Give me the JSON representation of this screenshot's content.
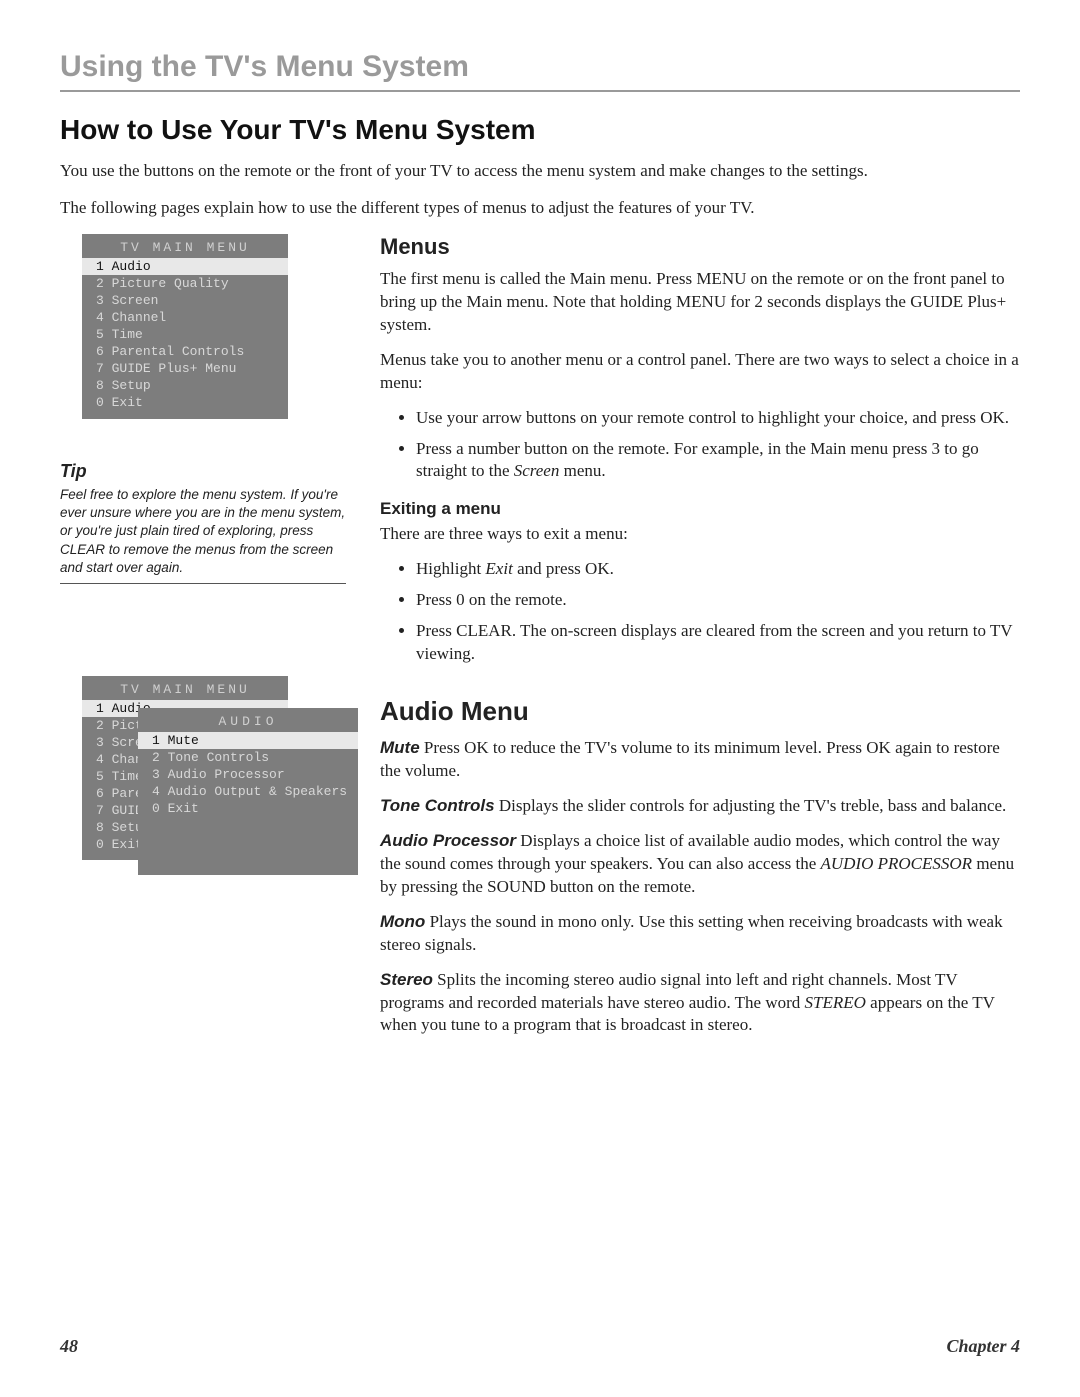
{
  "chapterTitle": "Using the TV's Menu System",
  "h1": "How to Use Your TV's Menu System",
  "intro1": "You use the buttons on the remote or the front of your TV to access the menu system and make changes to the settings.",
  "intro2": "The following pages explain how to use the different types of menus to adjust the features of your TV.",
  "osd1": {
    "title": "TV MAIN MENU",
    "items": [
      {
        "n": "1",
        "label": "Audio",
        "sel": true
      },
      {
        "n": "2",
        "label": "Picture Quality"
      },
      {
        "n": "3",
        "label": "Screen"
      },
      {
        "n": "4",
        "label": "Channel"
      },
      {
        "n": "5",
        "label": "Time"
      },
      {
        "n": "6",
        "label": "Parental Controls"
      },
      {
        "n": "7",
        "label": "GUIDE Plus+ Menu"
      },
      {
        "n": "8",
        "label": "Setup"
      },
      {
        "n": "0",
        "label": "Exit"
      }
    ]
  },
  "tip": {
    "heading": "Tip",
    "body": "Feel free to explore the menu system. If you're ever unsure where you are in the menu system, or you're just plain tired of exploring, press CLEAR to remove the menus from the screen and start over again."
  },
  "menus": {
    "heading": "Menus",
    "p1": "The first menu is called the Main menu. Press MENU on the remote or on the front panel to bring up the Main menu. Note that holding MENU for 2 seconds displays the GUIDE Plus+ system.",
    "p2": "Menus take you to another menu or a control panel. There are two ways to select a choice in a menu:",
    "bullets": [
      "Use your arrow buttons on your remote control to highlight your choice, and press OK.",
      "Press a number button on the remote. For example, in the Main menu press 3 to go straight to the Screen menu."
    ],
    "exitHeading": "Exiting a menu",
    "exitIntro": "There are three ways to exit a menu:",
    "exitBullets": [
      "Highlight Exit and press OK.",
      "Press 0 on the remote.",
      "Press CLEAR. The on-screen displays are cleared from the screen and you return to TV viewing."
    ]
  },
  "osd2": {
    "backTitle": "TV MAIN MENU",
    "backItems": [
      {
        "n": "1",
        "label": "Audio",
        "sel": true
      },
      {
        "n": "2",
        "label": "Pict"
      },
      {
        "n": "3",
        "label": "Scre"
      },
      {
        "n": "4",
        "label": "Chan"
      },
      {
        "n": "5",
        "label": "Time"
      },
      {
        "n": "6",
        "label": "Pare"
      },
      {
        "n": "7",
        "label": "GUID"
      },
      {
        "n": "8",
        "label": "Setu"
      },
      {
        "n": "0",
        "label": "Exit"
      }
    ],
    "frontTitle": "AUDIO",
    "frontItems": [
      {
        "n": "1",
        "label": "Mute",
        "sel": true
      },
      {
        "n": "2",
        "label": "Tone Controls"
      },
      {
        "n": "3",
        "label": "Audio Processor"
      },
      {
        "n": "4",
        "label": "Audio Output & Speakers"
      },
      {
        "n": "0",
        "label": "Exit"
      }
    ]
  },
  "audio": {
    "heading": "Audio Menu",
    "mute": {
      "term": "Mute",
      "text": "  Press OK to reduce the TV's volume to its minimum level. Press OK again to restore the volume."
    },
    "tone": {
      "term": "Tone Controls",
      "text": "   Displays the slider controls for adjusting the TV's treble, bass and balance."
    },
    "proc": {
      "term": "Audio Processor",
      "text": "   Displays a choice list of available audio modes, which control the way the sound comes through your speakers. You can also access the AUDIO PROCESSOR menu by pressing the SOUND button on the remote."
    },
    "mono": {
      "term": "Mono",
      "text": "   Plays the sound in mono only. Use this setting when receiving broadcasts with weak stereo signals."
    },
    "stereo": {
      "term": "Stereo",
      "text": "    Splits the incoming stereo audio signal into left and right channels. Most TV programs and recorded materials have stereo audio. The word STEREO appears on the TV when you tune to a program that is broadcast in stereo."
    }
  },
  "footer": {
    "page": "48",
    "chapter": "Chapter 4"
  }
}
